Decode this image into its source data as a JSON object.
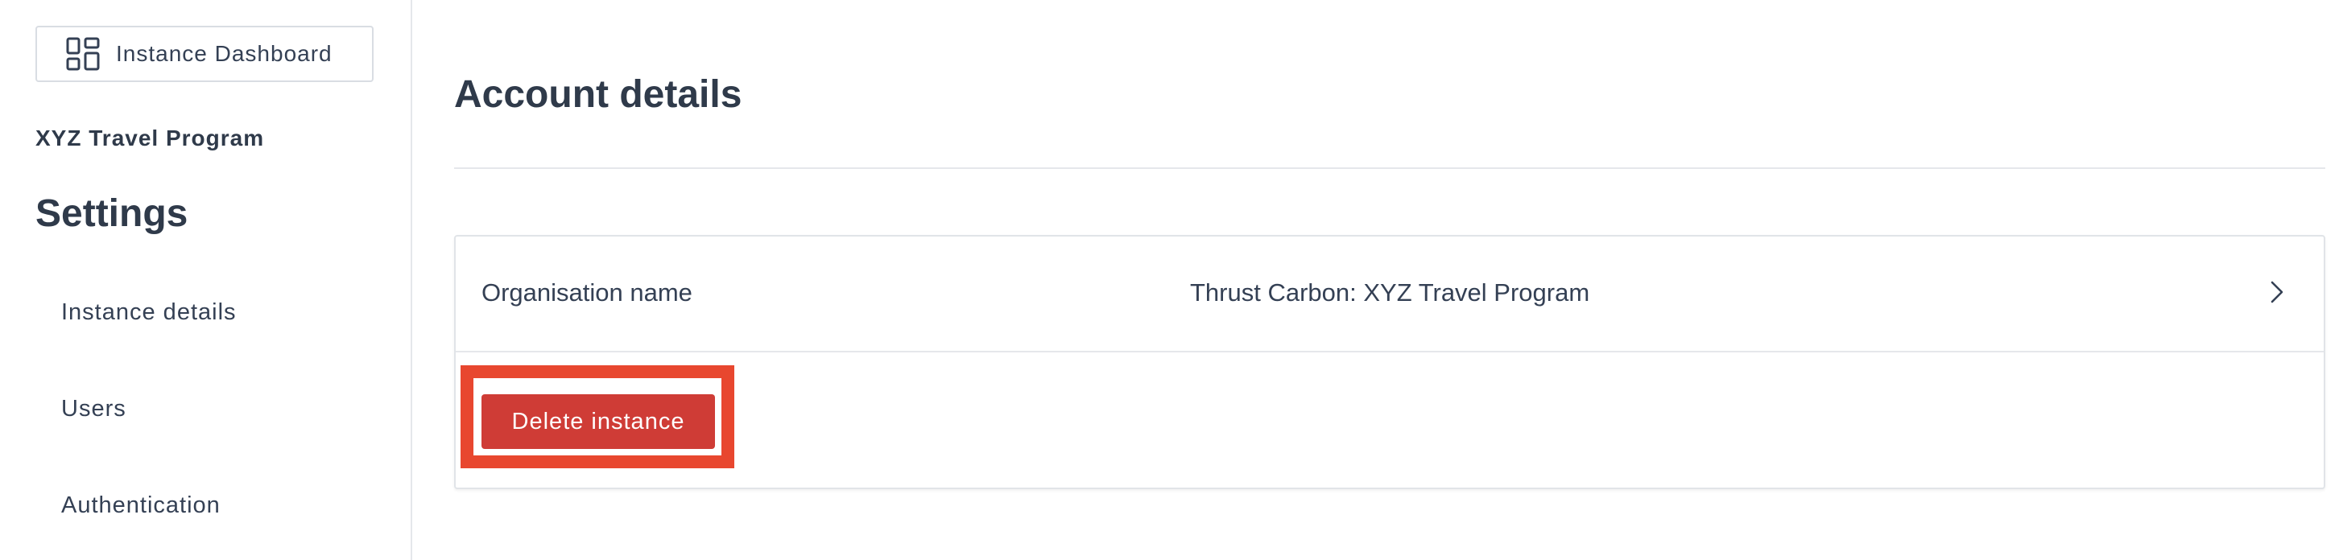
{
  "sidebar": {
    "dashboard_button_label": "Instance Dashboard",
    "dashboard_icon": "dashboard-grid-icon",
    "program_name": "XYZ Travel Program",
    "section_title": "Settings",
    "nav_items": [
      {
        "label": "Instance details"
      },
      {
        "label": "Users"
      },
      {
        "label": "Authentication"
      }
    ]
  },
  "main": {
    "page_title": "Account details",
    "card": {
      "rows": [
        {
          "label": "Organisation name",
          "value": "Thrust Carbon: XYZ Travel Program",
          "icon": "chevron-right-icon"
        }
      ],
      "delete_button_label": "Delete instance"
    }
  },
  "colors": {
    "text": "#344054",
    "heading": "#2f3a4a",
    "danger_button": "#cf3c36",
    "highlight_outline": "#e8472f",
    "border": "#e5e7eb"
  }
}
